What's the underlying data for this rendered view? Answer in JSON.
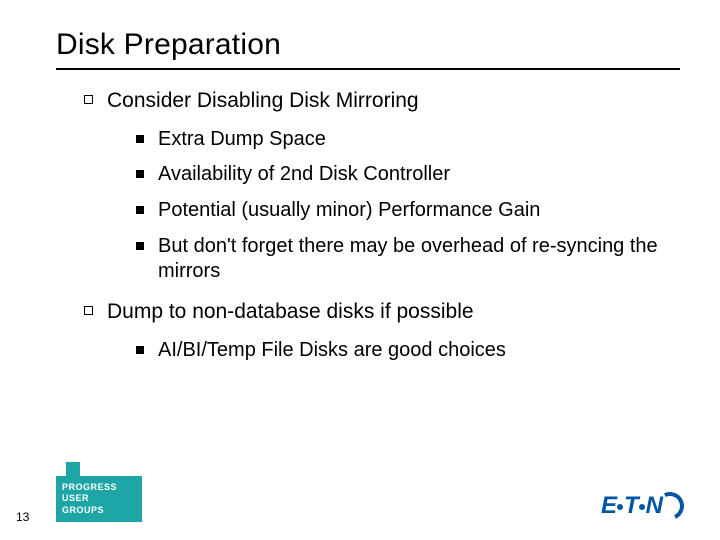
{
  "title": "Disk Preparation",
  "topics": [
    {
      "label": "Consider Disabling Disk Mirroring",
      "sub": [
        "Extra Dump Space",
        "Availability of 2nd Disk Controller",
        "Potential (usually minor) Performance Gain",
        "But don't forget there may be overhead of re-syncing the mirrors"
      ]
    },
    {
      "label": "Dump to non-database disks if possible",
      "sub": [
        "AI/BI/Temp File Disks are good choices"
      ]
    }
  ],
  "page_number": "13",
  "badge": {
    "line1": "PROGRESS",
    "line2": "USER",
    "line3": "GROUPS"
  },
  "logo": {
    "part1": "E",
    "part2": "T",
    "part3": "N"
  }
}
